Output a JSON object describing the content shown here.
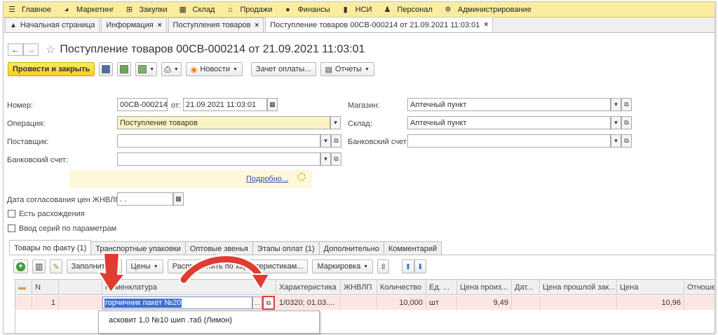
{
  "menu": [
    {
      "label": "Главное",
      "icon": "hamburger-icon",
      "glyph": "☰"
    },
    {
      "label": "Маркетинг",
      "icon": "marketing-icon",
      "glyph": "◕"
    },
    {
      "label": "Закупки",
      "icon": "purchases-icon",
      "glyph": "⊞"
    },
    {
      "label": "Склад",
      "icon": "warehouse-icon",
      "glyph": "▦"
    },
    {
      "label": "Продажи",
      "icon": "basket-icon",
      "glyph": "⌂"
    },
    {
      "label": "Финансы",
      "icon": "finance-icon",
      "glyph": "●"
    },
    {
      "label": "НСИ",
      "icon": "book-icon",
      "glyph": "▮"
    },
    {
      "label": "Персонал",
      "icon": "person-icon",
      "glyph": "♟"
    },
    {
      "label": "Администрирование",
      "icon": "gear-icon",
      "glyph": "✲"
    }
  ],
  "page_tabs": [
    {
      "label": "Начальная страница",
      "closable": false
    },
    {
      "label": "Информация",
      "closable": true
    },
    {
      "label": "Поступления товаров",
      "closable": true
    },
    {
      "label": "Поступление товаров 00СВ-000214 от 21.09.2021 11:03:01",
      "closable": true
    }
  ],
  "title": "Поступление товаров 00СВ-000214 от 21.09.2021 11:03:01",
  "toolbar": {
    "post_close": "Провести и закрыть",
    "news": "Новости",
    "payment_offset": "Зачет оплаты...",
    "reports": "Отчеты"
  },
  "form": {
    "number_label": "Номер:",
    "number_value": "00СВ-000214",
    "from_label": "от:",
    "date_value": "21.09.2021 11:03:01",
    "operation_label": "Операция:",
    "operation_value": "Поступление товаров",
    "supplier_label": "Поставщик:",
    "supplier_value": "",
    "bank_label": "Банковский счет:",
    "bank_value": "",
    "store_label": "Магазин:",
    "store_value": "Аптечный пункт",
    "warehouse_label": "Склад:",
    "warehouse_value": "Аптечный пункт",
    "bank2_label": "Банковский счет:",
    "bank2_value": "",
    "details_link": "Подробно...",
    "price_date_label": "Дата согласования цен ЖНВЛП:",
    "price_date_value": " .  .",
    "discrepancy_label": "Есть расхождения",
    "series_label": "Ввод серий по параметрам"
  },
  "inner_tabs": [
    "Товары по факту (1)",
    "Транспортные упаковки",
    "Оптовые звенья",
    "Этапы оплат (1)",
    "Дополнительно",
    "Комментарий"
  ],
  "table_toolbar": {
    "fill": "Заполнить",
    "prices": "Цены",
    "distribute": "Распределить по характеристикам...",
    "marking": "Маркировка"
  },
  "columns": [
    "",
    "N",
    "",
    "Номенклатура",
    "Характеристика",
    "ЖНВЛП",
    "Количество",
    "Ед. ...",
    "Цена произ...",
    "Дат...",
    "Цена прошлой зак...",
    "Цена",
    "Отношен"
  ],
  "row": {
    "n": "1",
    "nomenclature": "горчичник пакет №20",
    "characteristic": "1/0320; 01.03....",
    "qty": "10,000",
    "unit": "шт",
    "mfr_price": "9,49",
    "price": "10,96"
  },
  "dropdown_item": "асковит 1,0 №10 шип .таб (Лимон)",
  "colors": {
    "menubar": "#fbed9e",
    "primary": "#f4cf1c",
    "row": "#fbe6e3",
    "arrow": "#e03c31"
  }
}
